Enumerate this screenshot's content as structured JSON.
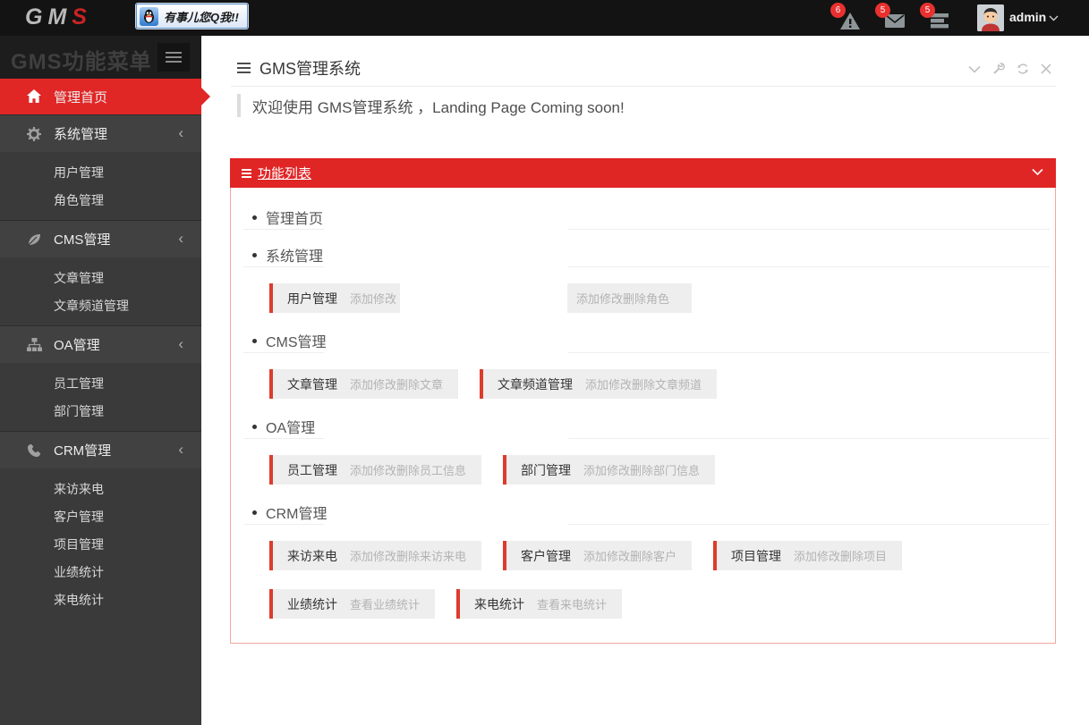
{
  "topbar": {
    "logo_gm": "GM",
    "logo_s": "S",
    "qq_badge_text": "有事儿您Q我!!",
    "notifications": [
      {
        "icon": "warning-triangle-icon",
        "count": "6"
      },
      {
        "icon": "envelope-icon",
        "count": "5"
      },
      {
        "icon": "tasks-icon",
        "count": "5"
      }
    ],
    "username": "admin"
  },
  "sidebar": {
    "title": "GMS功能菜单",
    "menu": [
      {
        "label": "管理首页"
      },
      {
        "label": "系统管理",
        "children": [
          "用户管理",
          "角色管理"
        ]
      },
      {
        "label": "CMS管理",
        "children": [
          "文章管理",
          "文章频道管理"
        ]
      },
      {
        "label": "OA管理",
        "children": [
          "员工管理",
          "部门管理"
        ]
      },
      {
        "label": "CRM管理",
        "children": [
          "来访来电",
          "客户管理",
          "项目管理",
          "业绩统计",
          "来电统计"
        ]
      }
    ]
  },
  "content": {
    "header_title": "GMS管理系统",
    "welcome": "欢迎使用 GMS管理系统 ，Landing Page Coming soon!",
    "panel": {
      "title": "功能列表",
      "sections": [
        {
          "title": "管理首页"
        },
        {
          "title": "系统管理"
        },
        {
          "title": "CMS管理"
        },
        {
          "title": "OA管理"
        },
        {
          "title": "CRM管理"
        }
      ],
      "chips": {
        "row1": [
          {
            "name": "用户管理",
            "perm": "添加修改"
          },
          {
            "perm": "添加修改删除角色"
          }
        ],
        "row2": [
          {
            "name": "文章管理",
            "perm": "添加修改删除文章"
          },
          {
            "name": "文章频道管理",
            "perm": "添加修改删除文章频道"
          }
        ],
        "row3": [
          {
            "name": "员工管理",
            "perm": "添加修改删除员工信息"
          },
          {
            "name": "部门管理",
            "perm": "添加修改删除部门信息"
          }
        ],
        "row4": [
          {
            "name": "来访来电",
            "perm": "添加修改删除来访来电"
          },
          {
            "name": "客户管理",
            "perm": "添加修改删除客户"
          },
          {
            "name": "项目管理",
            "perm": "添加修改删除项目"
          }
        ],
        "row5": [
          {
            "name": "业绩统计",
            "perm": "查看业绩统计"
          },
          {
            "name": "来电统计",
            "perm": "查看来电统计"
          }
        ]
      }
    }
  },
  "colors": {
    "accent_red": "#e02525",
    "sidebar_active_red": "#e12626",
    "chip_border_red": "#dd3c2c",
    "badge_red": "#e8312f",
    "panel_border": "#f0a79e",
    "topbar_bg": "#131313",
    "sidebar_bg": "#3a3a3a"
  }
}
